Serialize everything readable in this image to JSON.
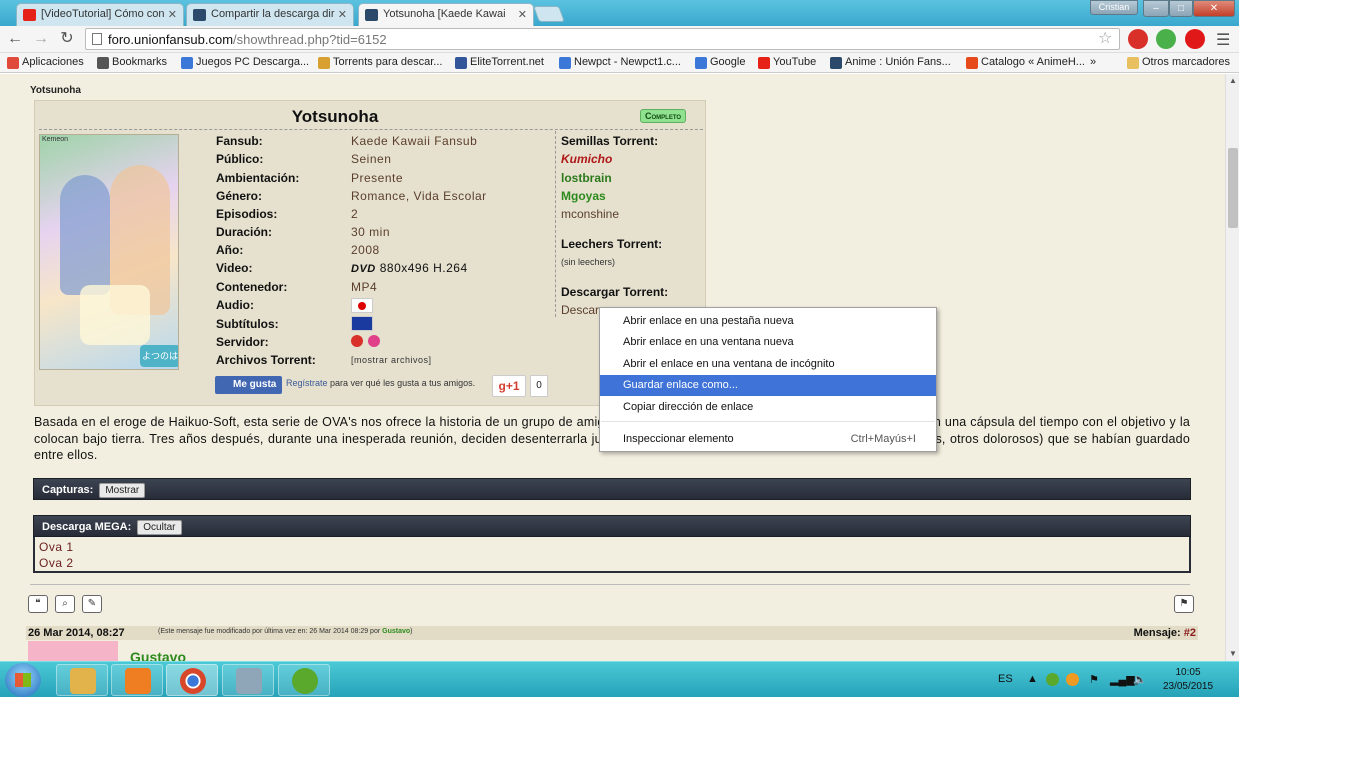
{
  "browser": {
    "tabs": [
      {
        "label": "[VideoTutorial] Cómo con",
        "favicon_color": "#e62117"
      },
      {
        "label": "Compartir la descarga dir",
        "favicon_color": "#2b4a6b"
      },
      {
        "label": "Yotsunoha [Kaede Kawai",
        "favicon_color": "#2b4a6b"
      }
    ],
    "user_label": "Cristian",
    "window_controls": {
      "minimize": "‒",
      "maximize": "□",
      "close": "✕"
    },
    "url_host": "foro.unionfansub.com",
    "url_path": "/showthread.php?tid=6152",
    "bookmarks": [
      {
        "label": "Aplicaciones",
        "color": "#e04a3a"
      },
      {
        "label": "Bookmarks",
        "color": "#555555"
      },
      {
        "label": "Juegos PC Descarga...",
        "color": "#3b78d8"
      },
      {
        "label": "Torrents para descar...",
        "color": "#d8a030"
      },
      {
        "label": "EliteTorrent.net",
        "color": "#335599"
      },
      {
        "label": "Newpct - Newpct1.c...",
        "color": "#3b78d8"
      },
      {
        "label": "Google",
        "color": "#3b78d8"
      },
      {
        "label": "YouTube",
        "color": "#e62117"
      },
      {
        "label": "Anime : Unión Fans...",
        "color": "#2b4a6b"
      },
      {
        "label": "Catalogo « AnimeH...",
        "color": "#e64a1a"
      }
    ],
    "bookmarks_overflow": "»",
    "other_bookmarks": "Otros marcadores",
    "icons": {
      "back": "back-arrow-icon",
      "forward": "forward-arrow-icon",
      "reload": "reload-icon",
      "star": "star-icon",
      "menu": "hamburger-menu-icon"
    }
  },
  "post": {
    "poster": "Yotsunoha",
    "title": "Yotsunoha",
    "status_badge": "Completo",
    "fields": [
      {
        "label": "Fansub:",
        "value": "Kaede Kawaii Fansub"
      },
      {
        "label": "Público:",
        "value": "Seinen"
      },
      {
        "label": "Ambientación:",
        "value": "Presente"
      },
      {
        "label": "Género:",
        "value": "Romance, Vida Escolar"
      },
      {
        "label": "Episodios:",
        "value": "2"
      },
      {
        "label": "Duración:",
        "value": "30 min"
      },
      {
        "label": "Año:",
        "value": "2008"
      },
      {
        "label": "Video:",
        "value": "880x496 H.264",
        "logo": "DVD"
      },
      {
        "label": "Contenedor:",
        "value": "MP4"
      },
      {
        "label": "Audio:",
        "value": ""
      },
      {
        "label": "Subtítulos:",
        "value": ""
      },
      {
        "label": "Servidor:",
        "value": ""
      },
      {
        "label": "Archivos Torrent:",
        "value": "[mostrar archivos]"
      }
    ],
    "seeders_title": "Semillas Torrent:",
    "seeders": [
      {
        "name": "Kumicho",
        "color": "#b01818"
      },
      {
        "name": "lostbrain",
        "color": "#2c7a1c"
      },
      {
        "name": "Mgoyas",
        "color": "#2c8a1c"
      },
      {
        "name": "mconshine",
        "color": "#5a3e2b"
      }
    ],
    "leechers_title": "Leechers Torrent:",
    "leechers_value": "(sin leechers)",
    "download_title": "Descargar Torrent:",
    "download_partial": "Descar",
    "cover_label": "よつのは",
    "cover_brand": "Kemeon",
    "facebook": {
      "button": "Me gusta",
      "link": "Regístrate",
      "text": "para ver qué les gusta a tus amigos."
    },
    "gplus": {
      "label": "g+1",
      "count": "0"
    },
    "synopsis": "Basada en el eroge de Haikuo-Soft, esta serie de OVA's nos ofrece la historia de un grupo de amigos que, para no olvidar los recuerdos que los unen, arman una cápsula del tiempo con el objetivo y la colocan bajo tierra. Tres años después, durante una inesperada reunión, deciden desenterrarla justamente para descubrir los secretos (algunos placenteros, otros dolorosos) que se habían guardado entre ellos.",
    "captures_label": "Capturas:",
    "captures_button": "Mostrar",
    "mega_label": "Descarga MEGA:",
    "mega_button": "Ocultar",
    "mega_items": [
      "Ova 1",
      "Ova 2"
    ]
  },
  "next_post": {
    "date": "26 Mar 2014, 08:27",
    "edit_note_prefix": "(Este mensaje fue modificado por última vez en: 26 Mar 2014 08:29 por",
    "edit_note_user": "Gustavo",
    "edit_note_suffix": ")",
    "number_label": "Mensaje:",
    "number": "#2",
    "username": "Gustavo"
  },
  "context_menu": {
    "items": [
      {
        "label": "Abrir enlace en una pestaña nueva",
        "shortcut": ""
      },
      {
        "label": "Abrir enlace en una ventana nueva",
        "shortcut": ""
      },
      {
        "label": "Abrir el enlace en una ventana de incógnito",
        "shortcut": ""
      },
      {
        "label": "Guardar enlace como...",
        "shortcut": ""
      },
      {
        "label": "Copiar dirección de enlace",
        "shortcut": ""
      },
      {
        "label": "Inspeccionar elemento",
        "shortcut": "Ctrl+Mayús+I"
      }
    ],
    "highlighted_index": 3
  },
  "taskbar": {
    "apps": [
      {
        "name": "file-explorer",
        "color": "#e2b34a"
      },
      {
        "name": "media-player",
        "color": "#ef7d22"
      },
      {
        "name": "chrome",
        "color": "#d9472b"
      },
      {
        "name": "calculator",
        "color": "#8fa6b8"
      },
      {
        "name": "utorrent",
        "color": "#5aa82c"
      }
    ],
    "language": "ES",
    "time": "10:05",
    "date": "23/05/2015"
  }
}
